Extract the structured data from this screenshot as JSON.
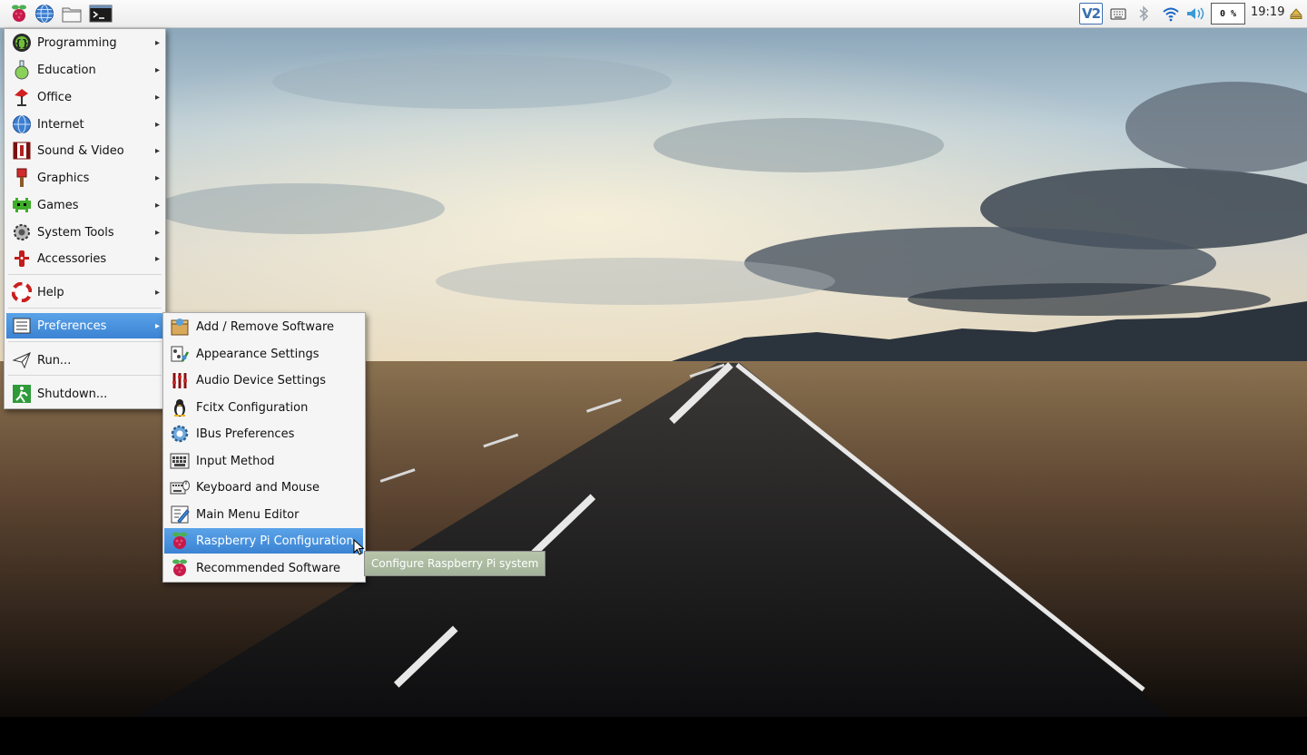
{
  "panel": {
    "launchers": [
      {
        "icon": "raspberry-menu-icon"
      },
      {
        "icon": "web-browser-icon"
      },
      {
        "icon": "file-manager-icon"
      },
      {
        "icon": "terminal-icon"
      }
    ],
    "tray": {
      "vnc_label": "V2",
      "cpu_usage": "0 %",
      "clock": "19:19"
    }
  },
  "main_menu": {
    "items": [
      {
        "label": "Programming",
        "icon": "programming-icon",
        "submenu": true
      },
      {
        "label": "Education",
        "icon": "education-icon",
        "submenu": true
      },
      {
        "label": "Office",
        "icon": "office-icon",
        "submenu": true
      },
      {
        "label": "Internet",
        "icon": "internet-icon",
        "submenu": true
      },
      {
        "label": "Sound & Video",
        "icon": "sound-video-icon",
        "submenu": true
      },
      {
        "label": "Graphics",
        "icon": "graphics-icon",
        "submenu": true
      },
      {
        "label": "Games",
        "icon": "games-icon",
        "submenu": true
      },
      {
        "label": "System Tools",
        "icon": "system-tools-icon",
        "submenu": true
      },
      {
        "label": "Accessories",
        "icon": "accessories-icon",
        "submenu": true
      },
      {
        "label": "Help",
        "icon": "help-icon",
        "submenu": true
      },
      {
        "label": "Preferences",
        "icon": "preferences-icon",
        "submenu": true,
        "active": true
      },
      {
        "label": "Run...",
        "icon": "run-icon",
        "submenu": false
      },
      {
        "label": "Shutdown...",
        "icon": "shutdown-icon",
        "submenu": false
      }
    ]
  },
  "preferences_menu": {
    "items": [
      {
        "label": "Add / Remove Software",
        "icon": "add-remove-software-icon"
      },
      {
        "label": "Appearance Settings",
        "icon": "appearance-settings-icon"
      },
      {
        "label": "Audio Device Settings",
        "icon": "audio-device-settings-icon"
      },
      {
        "label": "Fcitx Configuration",
        "icon": "fcitx-penguin-icon"
      },
      {
        "label": "IBus Preferences",
        "icon": "ibus-gear-icon"
      },
      {
        "label": "Input Method",
        "icon": "input-method-keyboard-icon"
      },
      {
        "label": "Keyboard and Mouse",
        "icon": "keyboard-mouse-icon"
      },
      {
        "label": "Main Menu Editor",
        "icon": "menu-editor-icon"
      },
      {
        "label": "Raspberry Pi Configuration",
        "icon": "raspberry-icon",
        "active": true
      },
      {
        "label": "Recommended Software",
        "icon": "raspberry-icon"
      }
    ]
  },
  "tooltip": {
    "text": "Configure Raspberry Pi system"
  },
  "colors": {
    "menu_highlight": "#3b83d3",
    "panel_bg": "#f2f2f2",
    "menu_bg": "#f5f5f5"
  }
}
